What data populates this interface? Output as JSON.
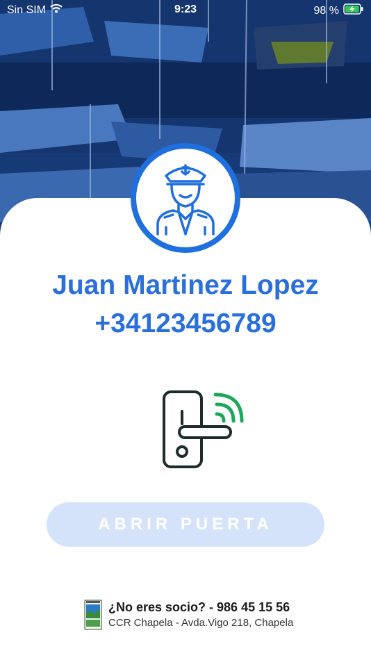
{
  "status_bar": {
    "carrier": "Sin SIM",
    "time": "9:23",
    "battery_pct": "98 %",
    "battery_level": 0.98,
    "wifi_icon": "wifi-icon",
    "battery_icon": "battery-charging-icon"
  },
  "hero": {
    "icon": "harbour-boats-photo"
  },
  "profile": {
    "avatar_icon": "ship-captain-icon",
    "name": "Juan Martinez Lopez",
    "phone": "+34123456789"
  },
  "door": {
    "icon": "smart-lock-icon",
    "button_label": "ABRIR PUERTA"
  },
  "footer": {
    "logo_icon": "club-crest-icon",
    "question": "¿No eres socio? - 986 45 15 56",
    "address": "CCR Chapela - Avda.Vigo 218, Chapela"
  },
  "colors": {
    "accent": "#2a6fdb",
    "avatar_ring": "#1f6fde",
    "button_bg": "#d5e3fa",
    "lock_signal": "#1fa65a",
    "lock_body": "#1e2b2b"
  }
}
